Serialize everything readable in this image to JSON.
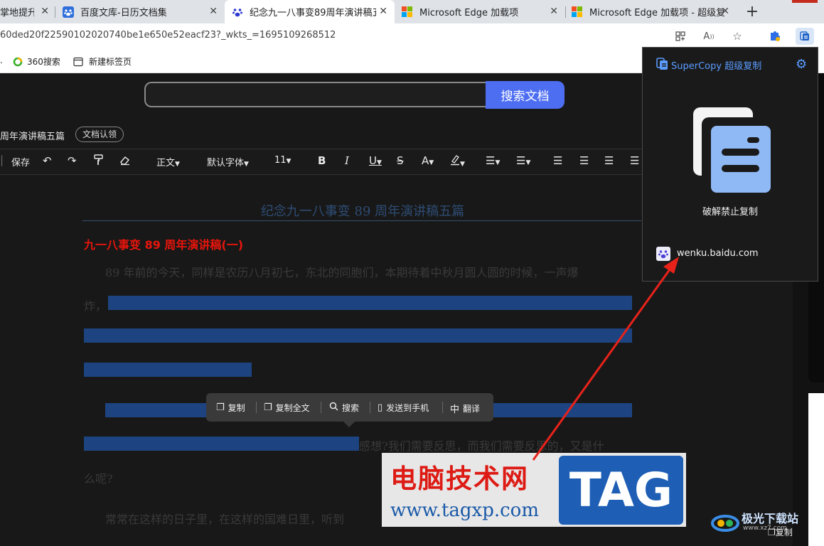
{
  "tabs": [
    {
      "title": "掌地提升E",
      "icon": "blue-page-icon",
      "active": false
    },
    {
      "title": "百度文库-日历文档集",
      "icon": "baidu-paw-icon",
      "active": false
    },
    {
      "title": "纪念九一八事变89周年演讲稿五",
      "icon": "baidu-paw-icon",
      "active": true
    },
    {
      "title": "Microsoft Edge 加载项",
      "icon": "microsoft-logo-icon",
      "active": false
    },
    {
      "title": "Microsoft Edge 加载项 - 超级复制",
      "icon": "microsoft-logo-icon",
      "active": false
    }
  ],
  "new_tab_symbol": "+",
  "close_symbol": "✕",
  "address": {
    "url": "60ded20f22590102020740be1e650e52eacf23?_wkts_=1695109268512"
  },
  "bookmarks": [
    {
      "label": "360搜索",
      "icon": "360-search-icon"
    },
    {
      "label": "新建标签页",
      "icon": "new-tab-page-icon"
    }
  ],
  "page": {
    "search_button": "搜索文档",
    "doc_title_small": "周年演讲稿五篇",
    "doc_claim": "文档认领",
    "toolbar": {
      "save": "保存",
      "style": "正文",
      "font": "默认字体",
      "size": "11"
    },
    "heading": "纪念九一八事变 89 周年演讲稿五篇",
    "sub_heading": "九一八事变 89 周年演讲稿(一)",
    "paragraphs": [
      "89 年前的今天，同样是农历八月初七，东北的同胞们，本期待着中秋月圆人圆的时候，一声爆",
      "炸，",
      "感想?我们需要反思，而我们需要反思的，又是什",
      "么呢?",
      "常常在这样的日子里，在这样的国难日里，听到"
    ]
  },
  "context_menu": {
    "items": [
      {
        "label": "复制",
        "icon": "copy-icon"
      },
      {
        "label": "复制全文",
        "icon": "copy-all-icon"
      },
      {
        "label": "搜索",
        "icon": "search-icon"
      },
      {
        "label": "发送到手机",
        "icon": "phone-icon"
      },
      {
        "label": "翻译",
        "icon": "translate-icon",
        "glyph": "中"
      }
    ]
  },
  "popup": {
    "title": "SuperCopy 超级复制",
    "action": "破解禁止复制",
    "site": "wenku.baidu.com"
  },
  "watermark": {
    "line1": "电脑技术网",
    "line2": "www.tagxp.com",
    "tag": "TAG"
  },
  "corner_logo": {
    "text": "极光下载站",
    "url": "www.xz7.com"
  },
  "copy_mini": "复制",
  "colors": {
    "accent_blue": "#4e6ef2",
    "popup_title": "#5b9cff",
    "red_heading": "#e8150c",
    "selection": "#1d4480"
  }
}
